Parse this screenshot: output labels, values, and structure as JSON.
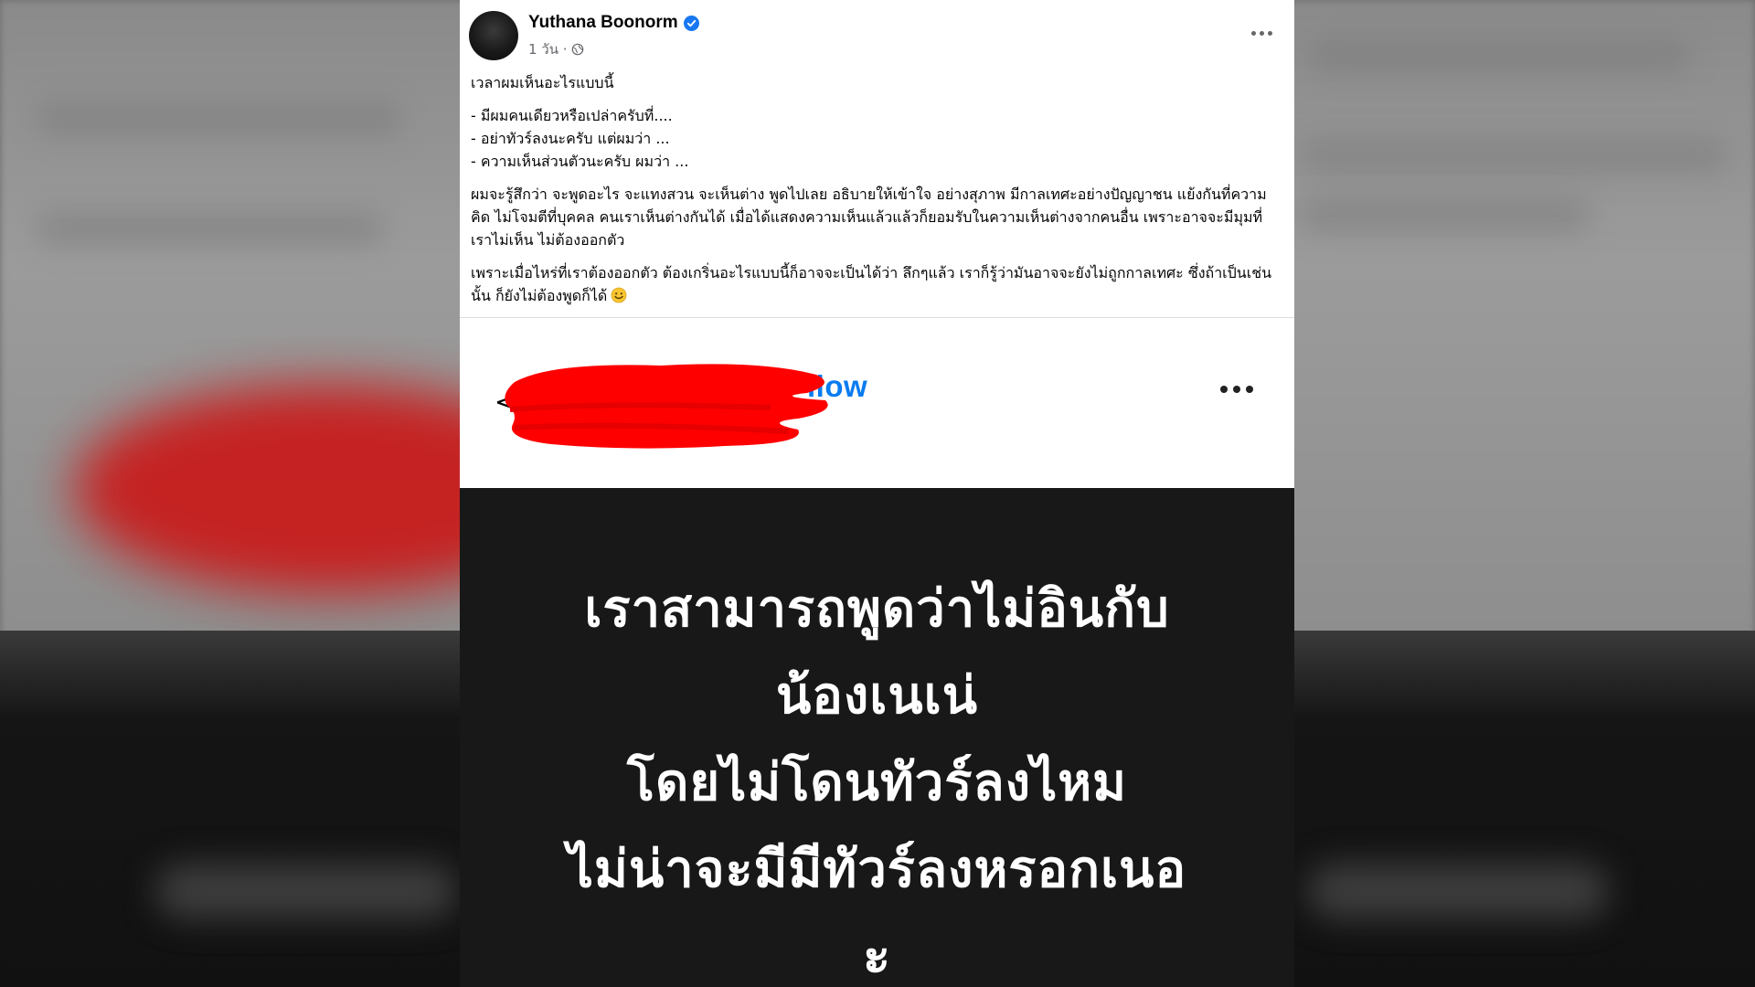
{
  "post": {
    "author": "Yuthana Boonorm",
    "verified": true,
    "meta": "1 วัน ·",
    "privacy_icon": "globe-icon",
    "more_icon": "more-horizontal-icon",
    "body": {
      "intro": "เวลาผมเห็นอะไรแบบนี้",
      "bullets": [
        "- มีผมคนเดียวหรือเปล่าครับที่....",
        "- อย่าทัวร์ลงนะครับ แต่ผมว่า ...",
        "- ความเห็นส่วนตัวนะครับ ผมว่า ..."
      ],
      "paragraph1": "ผมจะรู้สึกว่า จะพูดอะไร จะแทงสวน จะเห็นต่าง พูดไปเลย อธิบายให้เข้าใจ อย่างสุภาพ มีกาลเทศะอย่างปัญญาชน แย้งกันที่ความคิด ไม่โจมตีที่บุคคล คนเราเห็นต่างกันได้ เมื่อได้แสดงความเห็นแล้วแล้วก็ยอมรับในความเห็นต่างจากคนอื่น เพราะอาจจะมีมุมที่เราไม่เห็น ไม่ต้องออกตัว",
      "paragraph2": "เพราะเมื่อไหร่ที่เราต้องออกตัว ต้องเกริ่นอะไรแบบนี้ก็อาจจะเป็นได้ว่า ลึกๆแล้ว เราก็รู้ว่ามันอาจจะยังไม่ถูกกาลเทศะ ซึ่งถ้าเป็นเช่นนั้น ก็ยังไม่ต้องพูดก็ได้",
      "emoji": "smile-emoji-icon"
    }
  },
  "embed": {
    "back_icon": "<",
    "follow_text": "llow",
    "more_icon": "more-horizontal-icon",
    "redaction_color": "#ff0000",
    "story_lines": [
      "เราสามารถพูดว่าไม่อินกับ",
      "น้องเนเน่",
      "โดยไม่โดนทัวร์ลงไหม",
      "ไม่น่าจะมีมีทัวร์ลงหรอกเนอ",
      "ะ"
    ]
  },
  "colors": {
    "facebook_blue": "#1877f2",
    "text_primary": "#050505",
    "text_secondary": "#65676b",
    "story_background": "#181818"
  }
}
